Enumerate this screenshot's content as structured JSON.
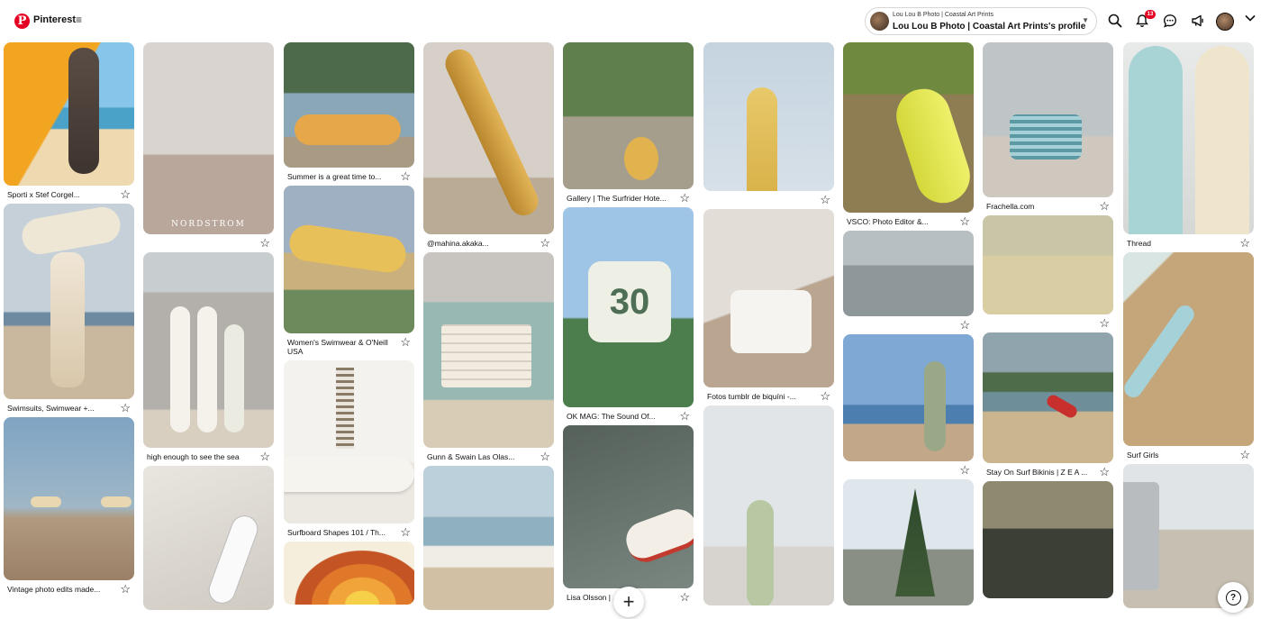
{
  "header": {
    "brand": "Pinterest",
    "menu_icon": "hamburger-icon",
    "profile": {
      "subtitle": "Lou Lou B Photo | Coastal Art Prints",
      "name": "Lou Lou B Photo | Coastal Art Prints's profile"
    },
    "notification_count": "13",
    "icons": [
      "search-icon",
      "bell-icon",
      "messages-icon",
      "megaphone-icon",
      "user-avatar",
      "chevron-down-icon"
    ]
  },
  "columns": [
    [
      {
        "title": "Sporti x Stef Corgel...",
        "img": "surfer-wetsuit-yellow-board"
      },
      {
        "title": "Swimsuits, Swimwear +...",
        "img": "woman-board-on-head"
      },
      {
        "title": "Vintage photo edits made...",
        "img": "vintage-two-surfers-beach"
      }
    ],
    [
      {
        "title": "",
        "img": "woman-tall-board-nordstrom",
        "watermark": "NORDSTROM"
      },
      {
        "title": "high enough to see the sea",
        "img": "boards-against-wall"
      },
      {
        "title": "",
        "img": "sand-surfer-white-board"
      }
    ],
    [
      {
        "title": "Summer is a great time to...",
        "img": "vw-bug-surfboard"
      },
      {
        "title": "Women's Swimwear & O'Neill USA",
        "img": "woman-yellow-boards"
      },
      {
        "title": "Surfboard Shapes 101 / Th...",
        "img": "towel-and-surfboard"
      },
      {
        "title": "",
        "img": "orange-retro-pattern"
      }
    ],
    [
      {
        "title": "@mahina.akaka...",
        "img": "woman-yellow-fin-board"
      },
      {
        "title": "Gunn & Swain Las Olas...",
        "img": "woody-car-towel"
      },
      {
        "title": "",
        "img": "surfers-beach-rocks"
      }
    ],
    [
      {
        "title": "Gallery | The Surfrider Hote...",
        "img": "garden-path-board"
      },
      {
        "title": "OK MAG: The Sound Of...",
        "img": "woman-sunglasses-30-shirt"
      },
      {
        "title": "Lisa Olsson | ...an",
        "img": "woman-water-surfboard"
      }
    ],
    [
      {
        "title": "",
        "img": "yellow-board-sky"
      },
      {
        "title": "Fotos tumblr de biquíni -...",
        "img": "woman-hat-white-tee"
      },
      {
        "title": "",
        "img": "woman-green-board-hazy"
      }
    ],
    [
      {
        "title": "VSCO: Photo Editor &...",
        "img": "lime-board-grass"
      },
      {
        "title": "",
        "img": "friends-in-shallow-water"
      },
      {
        "title": "",
        "img": "woman-wetsuit-beach-town"
      },
      {
        "title": "",
        "img": "pine-tree-house"
      }
    ],
    [
      {
        "title": "Frachella.com",
        "img": "woman-striped-bikini"
      },
      {
        "title": "",
        "img": "vintage-beach-women"
      },
      {
        "title": "Stay On Surf Bikinis | Z E A ...",
        "img": "two-surfers-red-board"
      },
      {
        "title": "",
        "img": "dusk-surfers-silhouette"
      }
    ],
    [
      {
        "title": "Thread",
        "img": "rainbow-boards"
      },
      {
        "title": "Surf Girls",
        "img": "aerial-sand-board"
      },
      {
        "title": "",
        "img": "van-surfer-beach"
      }
    ]
  ],
  "fab": {
    "add_icon": "plus-icon",
    "help_icon": "help-icon",
    "help_glyph": "?"
  }
}
